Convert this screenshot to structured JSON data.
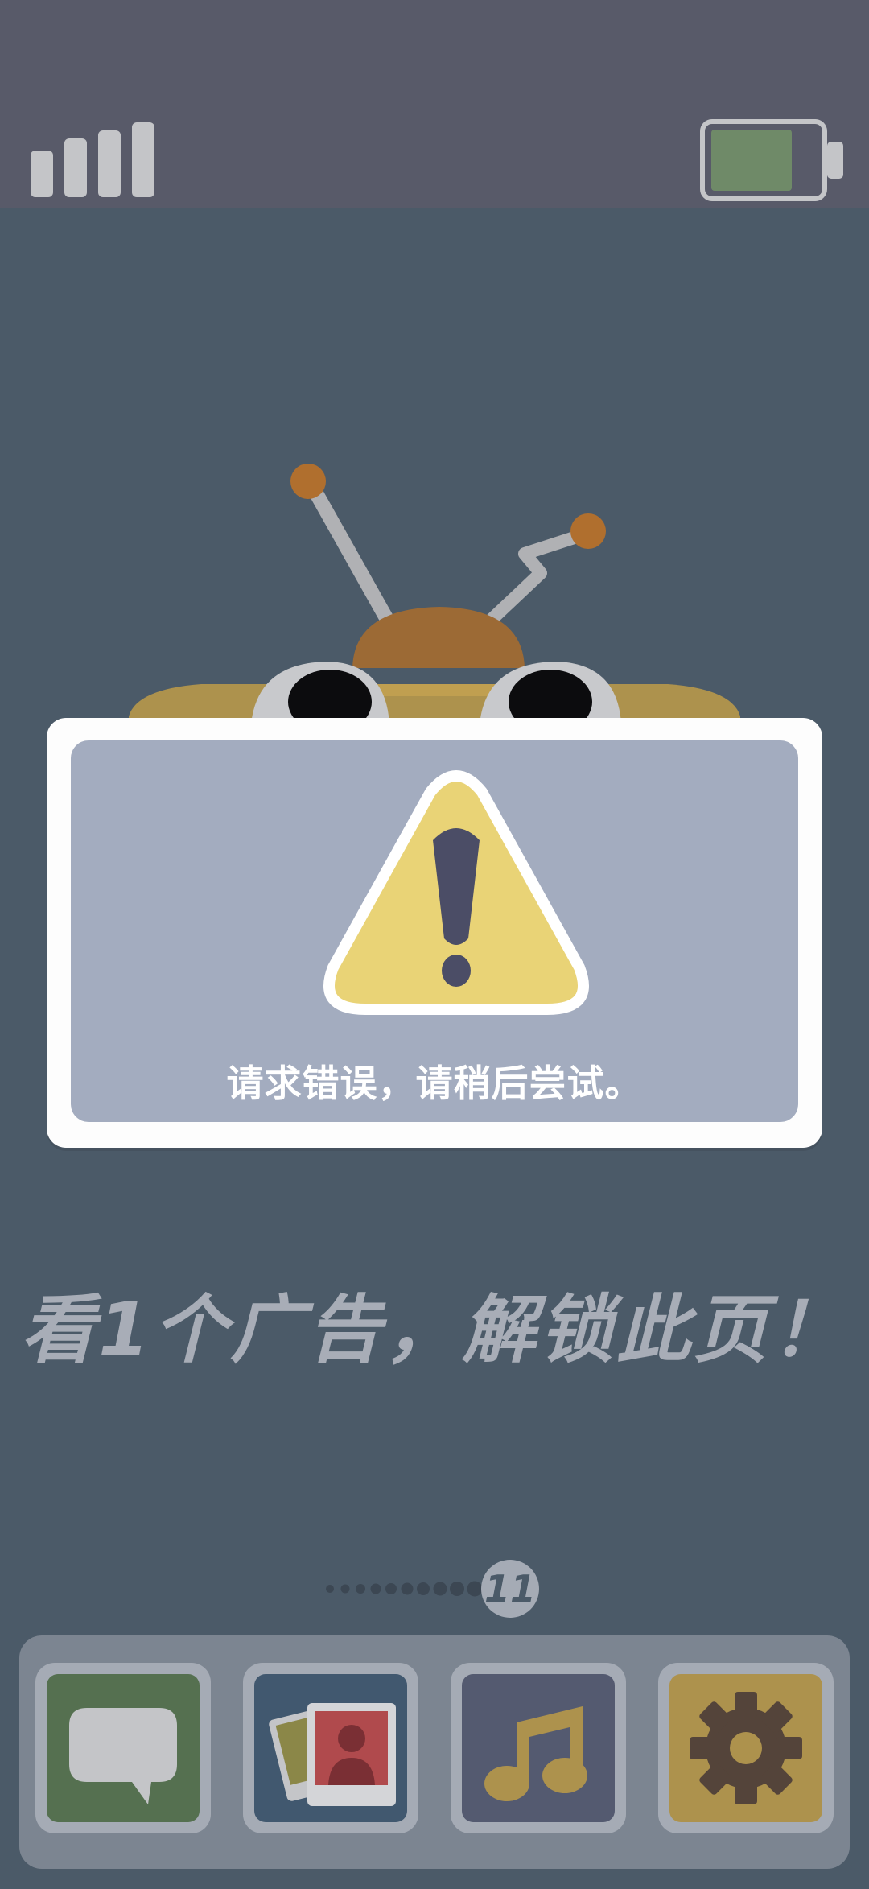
{
  "status_bar": {
    "signal_icon": "signal-bars-icon",
    "battery_icon": "battery-icon",
    "battery_level": 0.65,
    "battery_color": "#6f8a68"
  },
  "robot": {
    "icon": "robot-icon",
    "body_color": "#ad924d",
    "head_color": "#9c6a35",
    "antenna_tip_color": "#b06f2e"
  },
  "dialog": {
    "icon": "warning-icon",
    "message": "请求错误，请稍后尝试。",
    "warning_color": "#e9d376"
  },
  "unlock_prompt": "看1个广告，解锁此页！",
  "pager": {
    "current_page": "11",
    "total_dots": 10
  },
  "dock": {
    "apps": [
      {
        "name": "messages",
        "icon": "speech-bubble-icon",
        "color": "#557050"
      },
      {
        "name": "photos",
        "icon": "photos-icon",
        "color": "#41586f"
      },
      {
        "name": "music",
        "icon": "music-note-icon",
        "color": "#545a70"
      },
      {
        "name": "settings",
        "icon": "gear-icon",
        "color": "#ad924d"
      }
    ]
  }
}
